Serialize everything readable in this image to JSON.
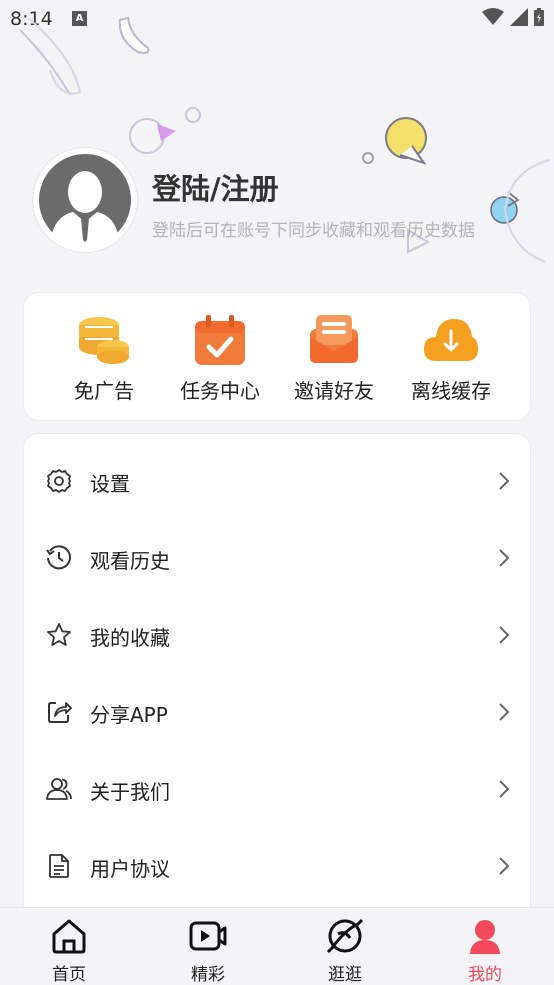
{
  "status_bar": {
    "time": "8:14",
    "notif_letter": "A"
  },
  "profile": {
    "title": "登陆/注册",
    "subtitle": "登陆后可在账号下同步收藏和观看历史数据"
  },
  "quick_actions": [
    {
      "label": "免广告",
      "icon": "coins-icon"
    },
    {
      "label": "任务中心",
      "icon": "calendar-check-icon"
    },
    {
      "label": "邀请好友",
      "icon": "envelope-icon"
    },
    {
      "label": "离线缓存",
      "icon": "cloud-download-icon"
    }
  ],
  "menu": [
    {
      "label": "设置",
      "icon": "gear-icon"
    },
    {
      "label": "观看历史",
      "icon": "history-icon"
    },
    {
      "label": "我的收藏",
      "icon": "star-icon"
    },
    {
      "label": "分享APP",
      "icon": "share-icon"
    },
    {
      "label": "关于我们",
      "icon": "users-icon"
    },
    {
      "label": "用户协议",
      "icon": "document-icon"
    }
  ],
  "bottom_nav": [
    {
      "label": "首页",
      "icon": "home-icon",
      "active": false
    },
    {
      "label": "精彩",
      "icon": "video-icon",
      "active": false
    },
    {
      "label": "逛逛",
      "icon": "compass-icon",
      "active": false
    },
    {
      "label": "我的",
      "icon": "person-icon",
      "active": true
    }
  ],
  "colors": {
    "accent": "#f24a5b",
    "orange": "#f07a3a",
    "gold": "#f4b73a"
  }
}
